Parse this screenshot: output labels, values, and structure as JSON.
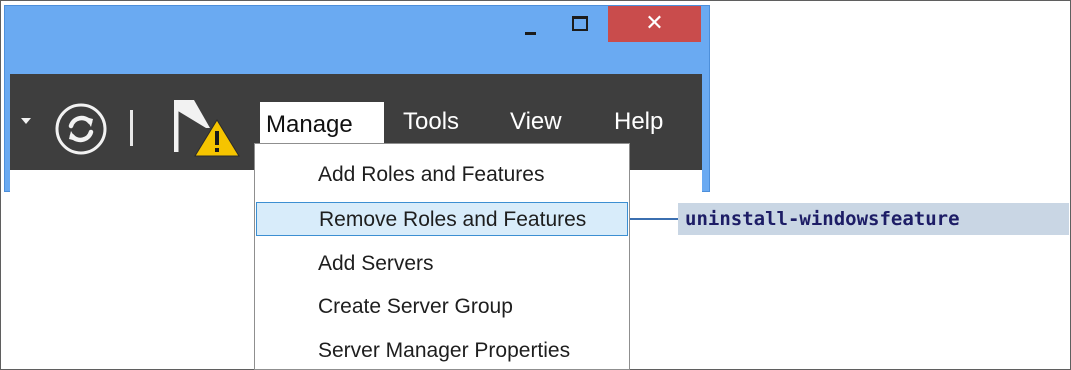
{
  "titlebar": {
    "close_glyph": "✕"
  },
  "toolbar": {
    "menus": [
      {
        "label": "Manage"
      },
      {
        "label": "Tools"
      },
      {
        "label": "View"
      },
      {
        "label": "Help"
      }
    ],
    "icons": [
      "dropdown-caret-icon",
      "refresh-icon",
      "notifications-flag-warning-icon"
    ]
  },
  "manage_menu": {
    "items": [
      {
        "label": "Add Roles and Features"
      },
      {
        "label": "Remove Roles and Features",
        "highlighted": true
      },
      {
        "label": "Add Servers"
      },
      {
        "label": "Create Server Group"
      },
      {
        "label": "Server Manager Properties"
      }
    ]
  },
  "callout": {
    "command": "uninstall-windowsfeature"
  },
  "colors": {
    "title_bar": "#6aaaf2",
    "toolbar": "#3e3e3e",
    "close_button": "#c94c4c",
    "highlight": "#d8ecfa",
    "highlight_border": "#3c8fd2",
    "callout_bg": "#c9d6e4",
    "callout_text": "#1d1d66"
  }
}
